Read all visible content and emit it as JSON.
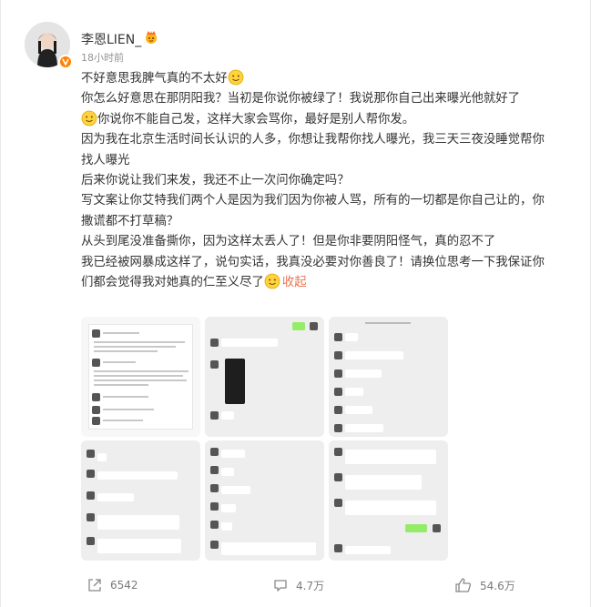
{
  "user": {
    "name": "李恩LIEN_",
    "time": "18小时前"
  },
  "post": {
    "l1": "不好意思我脾气真的不太好",
    "l2": "你怎么好意思在那阴阳我？当初是你说你被绿了！我说那你自己出来曝光他就好了",
    "l3": "你说你不能自己发，这样大家会骂你，最好是别人帮你发。",
    "l4": "因为我在北京生活时间长认识的人多，你想让我帮你找人曝光，我三天三夜没睡觉帮你",
    "l5": "找人曝光",
    "l6": "后来你说让我们来发，我还不止一次问你确定吗？",
    "l7": "写文案让你艾特我们两个人是因为我们因为你被人骂，所有的一切都是你自己让的，你",
    "l8": "撒谎都不打草稿？",
    "l9": "从头到尾没准备撕你，因为这样太丢人了！但是你非要阴阳怪气，真的忍不了",
    "l10": "我已经被网暴成这样了，说句实话，我真没必要对你善良了！请换位思考一下我保证你",
    "l11": "们都会觉得我对她真的仁至义尽了",
    "collapse": "收起"
  },
  "footer": {
    "share_count": "6542",
    "comment_count": "4.7万",
    "like_count": "54.6万"
  },
  "colors": {
    "accent": "#eb7350",
    "vip": "#ff8200",
    "muted": "#939393"
  }
}
